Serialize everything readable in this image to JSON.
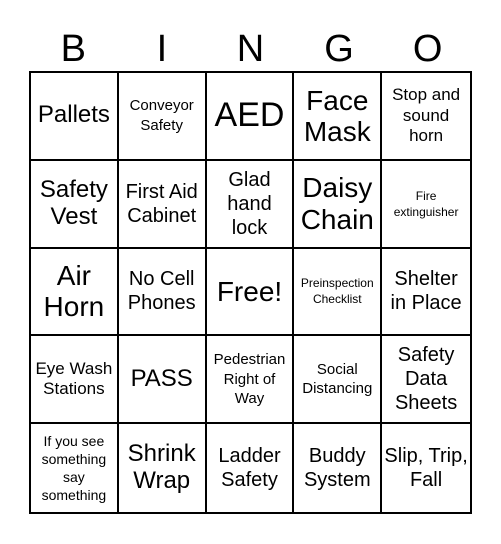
{
  "header": [
    "B",
    "I",
    "N",
    "G",
    "O"
  ],
  "cells": [
    {
      "text": "Pallets",
      "size": "s-ml"
    },
    {
      "text": "Conveyor Safety",
      "size": "s-s"
    },
    {
      "text": "AED",
      "size": "s-xl"
    },
    {
      "text": "Face Mask",
      "size": "s-l"
    },
    {
      "text": "Stop and sound horn",
      "size": "s-sm"
    },
    {
      "text": "Safety Vest",
      "size": "s-ml"
    },
    {
      "text": "First Aid Cabinet",
      "size": "s-m"
    },
    {
      "text": "Glad hand lock",
      "size": "s-m"
    },
    {
      "text": "Daisy Chain",
      "size": "s-l"
    },
    {
      "text": "Fire extinguisher",
      "size": "s-xxs"
    },
    {
      "text": "Air Horn",
      "size": "s-l"
    },
    {
      "text": "No Cell Phones",
      "size": "s-m"
    },
    {
      "text": "Free!",
      "size": "s-l"
    },
    {
      "text": "Preinspection Checklist",
      "size": "s-xxs"
    },
    {
      "text": "Shelter in Place",
      "size": "s-m"
    },
    {
      "text": "Eye Wash Stations",
      "size": "s-sm"
    },
    {
      "text": "PASS",
      "size": "s-ml"
    },
    {
      "text": "Pedestrian Right of Way",
      "size": "s-s"
    },
    {
      "text": "Social Distancing",
      "size": "s-s"
    },
    {
      "text": "Safety Data Sheets",
      "size": "s-m"
    },
    {
      "text": "If you see something say something",
      "size": "s-xs"
    },
    {
      "text": "Shrink Wrap",
      "size": "s-ml"
    },
    {
      "text": "Ladder Safety",
      "size": "s-m"
    },
    {
      "text": "Buddy System",
      "size": "s-m"
    },
    {
      "text": "Slip, Trip, Fall",
      "size": "s-m"
    }
  ]
}
